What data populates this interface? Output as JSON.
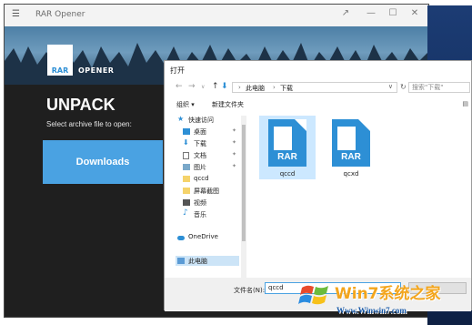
{
  "app": {
    "title": "RAR Opener",
    "menu_icon": "hamburger-icon",
    "controls": [
      "↗",
      "—",
      "☐",
      "✕"
    ],
    "logo": {
      "mark_text": "RAR",
      "word": "OPENER"
    },
    "heading": "UNPACK",
    "subheading": "Select archive file to open:",
    "downloads_label": "Downloads",
    "accent": "#4aa2e2"
  },
  "dialog": {
    "title": "打开",
    "breadcrumb": [
      "此电脑",
      "下载"
    ],
    "search_placeholder": "搜索\"下载\"",
    "toolbar": {
      "organize": "组织 ▾",
      "new_folder": "新建文件夹"
    },
    "nav_items": [
      {
        "label": "快速访问",
        "icon": "star-icon",
        "pinned": false
      },
      {
        "label": "桌面",
        "icon": "desktop-icon",
        "pinned": true
      },
      {
        "label": "下载",
        "icon": "download-icon",
        "pinned": true
      },
      {
        "label": "文档",
        "icon": "document-icon",
        "pinned": true
      },
      {
        "label": "图片",
        "icon": "picture-icon",
        "pinned": true
      },
      {
        "label": "qccd",
        "icon": "folder-icon",
        "pinned": false
      },
      {
        "label": "屏幕截图",
        "icon": "folder-icon",
        "pinned": false
      },
      {
        "label": "视频",
        "icon": "video-icon",
        "pinned": false
      },
      {
        "label": "音乐",
        "icon": "music-icon",
        "pinned": false
      },
      {
        "label": "OneDrive",
        "icon": "cloud-icon",
        "pinned": false
      },
      {
        "label": "此电脑",
        "icon": "computer-icon",
        "pinned": false
      }
    ],
    "files": [
      {
        "name": "qccd",
        "badge": "RAR",
        "selected": true
      },
      {
        "name": "qcxd",
        "badge": "RAR",
        "selected": false
      }
    ],
    "file_name_label": "文件名(N):",
    "file_name_value": "qccd",
    "file_color": "#2d8fd5"
  },
  "watermark": {
    "text": "Win7系统之家",
    "url": "Www.Winwin7.com"
  }
}
